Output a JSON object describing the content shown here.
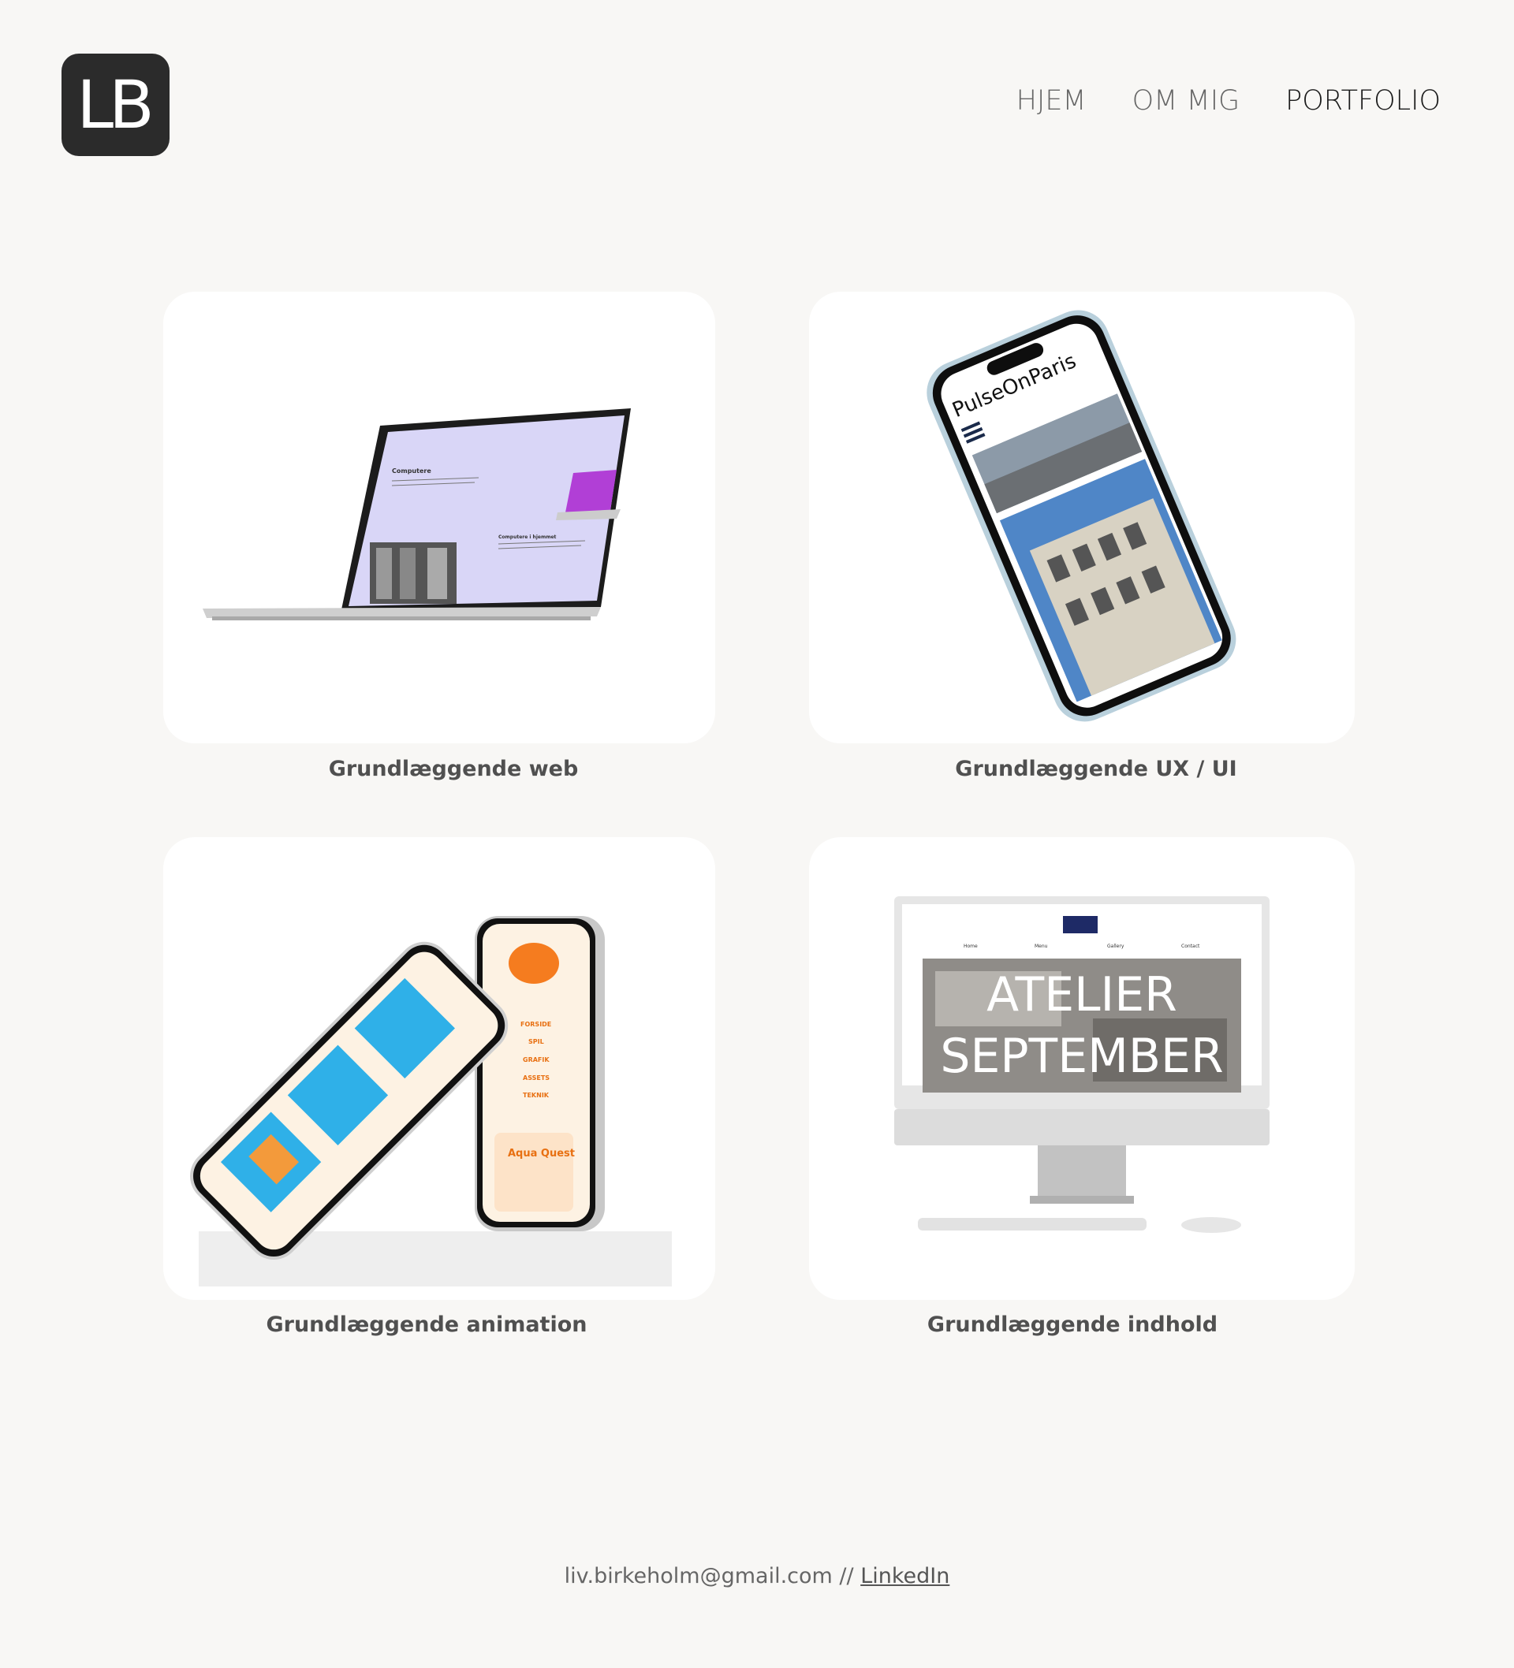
{
  "logo": {
    "text": "LB"
  },
  "nav": {
    "home": "HJEM",
    "about": "OM MIG",
    "portfolio": "PORTFOLIO"
  },
  "projects": [
    {
      "title": "Grundlæggende web",
      "mock_heading": "Computere",
      "mock_subheading": "Computere i hjemmet"
    },
    {
      "title": "Grundlæggende UX / UI",
      "mock_heading": "PulseOnParis"
    },
    {
      "title": "Grundlæggende animation",
      "mock_menu": [
        "FORSIDE",
        "SPIL",
        "GRAFIK",
        "ASSETS",
        "TEKNIK"
      ],
      "mock_subheading": "Aqua Quest"
    },
    {
      "title": "Grundlæggende indhold",
      "mock_nav": [
        "Home",
        "Menu",
        "Gallery",
        "Contact"
      ],
      "mock_heading_1": "ATELIER",
      "mock_heading_2": "SEPTEMBER"
    }
  ],
  "footer": {
    "email": "liv.birkeholm@gmail.com",
    "separator": " // ",
    "link": "LinkedIn"
  },
  "colors": {
    "background": "#f8f7f5",
    "logo_bg": "#2b2b2b",
    "card_bg": "#ffffff"
  }
}
